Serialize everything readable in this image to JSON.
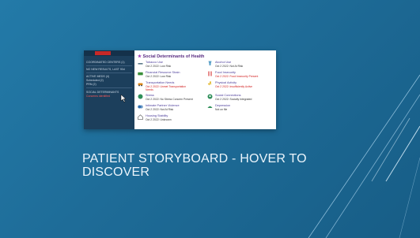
{
  "slide": {
    "title_line1": "PATIENT STORYBOARD - HOVER TO",
    "title_line2": "DISCOVER",
    "background_color": "#1f6e9a",
    "accent_color": "#a9d3ec"
  },
  "screenshot": {
    "sidebar": {
      "lines": [
        "COORDINATED CENTERS (1)",
        "NO NEW RESULTS, LAST 90d",
        "ACTIVE MEDS (4)",
        "Scheduled (2)",
        "PRN (2)",
        "SOCIAL DETERMINANTS",
        "Concerns identified"
      ]
    },
    "main": {
      "header": "Social Determinants of Health",
      "items": [
        {
          "title": "Tobacco Use",
          "detail": "Oct 2 2022: Low Risk",
          "icon": "cigarette-icon",
          "color": "#5c7a8a"
        },
        {
          "title": "Alcohol Use",
          "detail": "Oct 2 2022: Not At Risk",
          "icon": "glass-icon",
          "color": "#5aa0c8"
        },
        {
          "title": "Financial Resource Strain",
          "detail": "Oct 2 2022: Low Risk",
          "icon": "money-icon",
          "color": "#3a8f3a"
        },
        {
          "title": "Food Insecurity",
          "detail": "Oct 2 2022: Food Insecurity Present",
          "icon": "utensils-icon",
          "color": "#d11b1b",
          "alert": true
        },
        {
          "title": "Transportation Needs",
          "detail": "Oct 2 2022: Unmet Transportation",
          "detail2": "Needs",
          "icon": "car-icon",
          "color": "#e08a1a",
          "alert": true
        },
        {
          "title": "Physical Activity",
          "detail": "Oct 2 2022: Insufficiently Active",
          "icon": "runner-icon",
          "color": "#e0b21a",
          "alert": true
        },
        {
          "title": "Stress",
          "detail": "Oct 2 2022: No Stress Concern Present",
          "icon": "stress-icon",
          "color": "#2f8f5a"
        },
        {
          "title": "Social Connections",
          "detail": "Oct 2 2022: Socially Integrated",
          "icon": "people-icon",
          "color": "#2f8f5a"
        },
        {
          "title": "Intimate Partner Violence",
          "detail": "Oct 2 2022: Not At Risk",
          "icon": "partner-icon",
          "color": "#2f6fb0"
        },
        {
          "title": "Depression",
          "detail": "Not on file",
          "icon": "mood-icon",
          "color": "#2f8f5a"
        },
        {
          "title": "Housing Stability",
          "detail": "Oct 2 2022: Unknown",
          "icon": "house-icon",
          "color": "#7a7a7a"
        }
      ]
    }
  }
}
